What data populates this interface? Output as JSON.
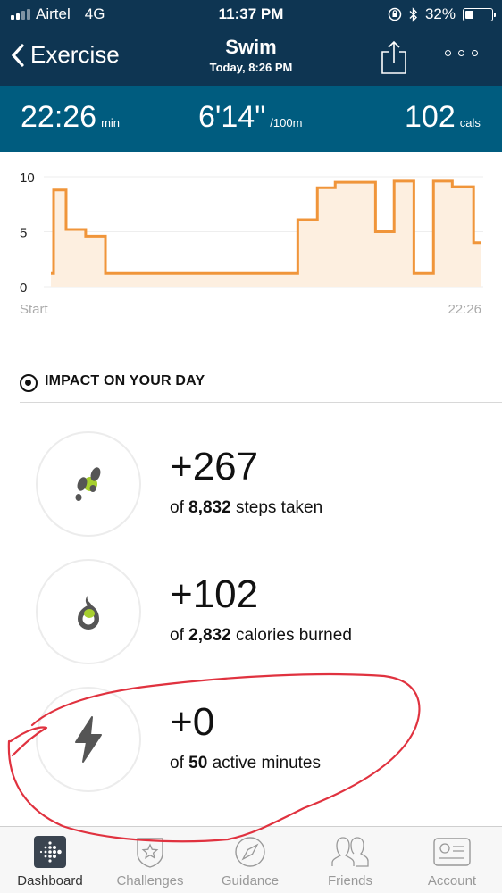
{
  "status_bar": {
    "carrier": "Airtel",
    "network": "4G",
    "time": "11:37 PM",
    "battery_percent": "32%",
    "battery_level": 0.32,
    "signal_bars_filled": 2,
    "signal_bars_total": 4
  },
  "nav": {
    "back_label": "Exercise",
    "title": "Swim",
    "subtitle": "Today, 8:26 PM"
  },
  "summary": {
    "duration": {
      "value": "22:26",
      "unit": "min"
    },
    "pace": {
      "value": "6'14\"",
      "unit": "/100m"
    },
    "calories": {
      "value": "102",
      "unit": "cals"
    }
  },
  "chart_data": {
    "type": "line",
    "style": "step-area",
    "title": "",
    "xlabel": "",
    "ylabel": "",
    "x_tick_labels": [
      "Start",
      "22:26"
    ],
    "y_ticks": [
      0,
      5,
      10
    ],
    "ylim": [
      0,
      10
    ],
    "xlim_minutes": [
      0,
      22.43
    ],
    "grid": true,
    "line_color": "#f0953a",
    "fill_color": "#fdefe0",
    "series": [
      {
        "name": "pace",
        "x_minutes": [
          0,
          0.14,
          0.79,
          1.81,
          2.84,
          12.86,
          13.88,
          14.81,
          16.91,
          17.88,
          18.91,
          19.93,
          20.91,
          22.02,
          22.43
        ],
        "values": [
          1.2,
          8.8,
          5.2,
          4.6,
          1.2,
          6.1,
          9.0,
          9.5,
          5.0,
          9.6,
          1.2,
          9.6,
          9.1,
          4.0,
          4.0
        ]
      }
    ]
  },
  "impact": {
    "heading": "IMPACT ON YOUR DAY",
    "items": [
      {
        "icon": "footsteps-icon",
        "delta": "+267",
        "prefix": "of",
        "total": "8,832",
        "suffix": "steps taken"
      },
      {
        "icon": "flame-icon",
        "delta": "+102",
        "prefix": "of",
        "total": "2,832",
        "suffix": "calories burned"
      },
      {
        "icon": "lightning-icon",
        "delta": "+0",
        "prefix": "of",
        "total": "50",
        "suffix": "active minutes"
      }
    ]
  },
  "tabbar": {
    "tabs": [
      {
        "label": "Dashboard",
        "icon": "fitbit-logo-icon",
        "active": true
      },
      {
        "label": "Challenges",
        "icon": "star-badge-icon",
        "active": false
      },
      {
        "label": "Guidance",
        "icon": "compass-icon",
        "active": false
      },
      {
        "label": "Friends",
        "icon": "friends-icon",
        "active": false
      },
      {
        "label": "Account",
        "icon": "account-card-icon",
        "active": false
      }
    ]
  },
  "colors": {
    "header_bg": "#0e3552",
    "summary_bg": "#005c7f",
    "chart_line": "#f0953a",
    "chart_fill": "#fdefe0",
    "accent_green": "#a6cf2e",
    "annotation_red": "#e0323f"
  }
}
